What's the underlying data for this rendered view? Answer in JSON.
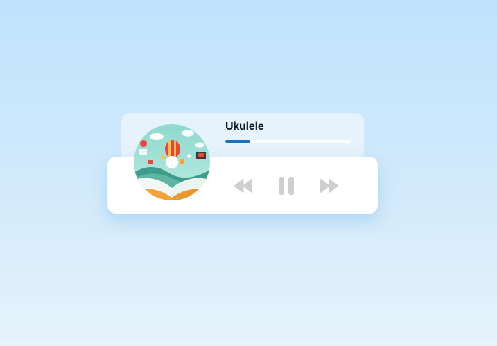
{
  "track": {
    "title": "Ukulele",
    "progress": 0.2
  },
  "controls": {
    "previous_icon": "rewind-icon",
    "pause_icon": "pause-icon",
    "next_icon": "fast-forward-icon"
  },
  "colors": {
    "background_top": "#bfe3fd",
    "background_bottom": "#e7f3fb",
    "progress_fill": "#1b74bb",
    "icon_gray": "#cfcfcf"
  }
}
